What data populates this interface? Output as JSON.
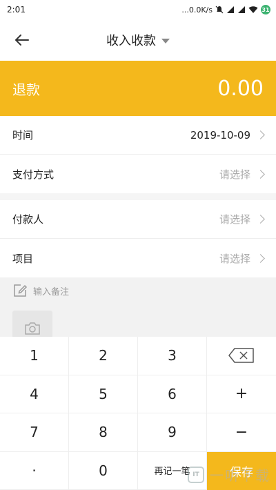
{
  "status_bar": {
    "time": "2:01",
    "network_speed": "...0.0K/s",
    "icons": [
      "mute-icon",
      "signal-icon",
      "signal-icon",
      "wifi-icon",
      "battery-icon"
    ],
    "battery_level": "31"
  },
  "nav": {
    "back_icon": "arrow-left-icon",
    "title": "收入收款",
    "title_dropdown_icon": "caret-down-icon"
  },
  "amount": {
    "type_label": "退款",
    "value": "0.00",
    "band_color": "#f4b81c"
  },
  "form": {
    "group1": [
      {
        "label": "时间",
        "value": "2019-10-09",
        "is_placeholder": false
      },
      {
        "label": "支付方式",
        "value": "请选择",
        "is_placeholder": true
      }
    ],
    "group2": [
      {
        "label": "付款人",
        "value": "请选择",
        "is_placeholder": true
      },
      {
        "label": "项目",
        "value": "请选择",
        "is_placeholder": true
      }
    ]
  },
  "remark": {
    "icon": "edit-icon",
    "placeholder": "输入备注",
    "photo_icon": "camera-icon"
  },
  "keypad": {
    "keys": [
      [
        "1",
        "2",
        "3",
        "backspace"
      ],
      [
        "4",
        "5",
        "6",
        "+"
      ],
      [
        "7",
        "8",
        "9",
        "−"
      ],
      [
        "·",
        "0",
        "再记一笔",
        "保存"
      ]
    ],
    "backspace_icon": "backspace-icon",
    "save_color": "#f4b81c"
  },
  "watermark": {
    "logo_text": "IT",
    "text": "一听下载"
  }
}
